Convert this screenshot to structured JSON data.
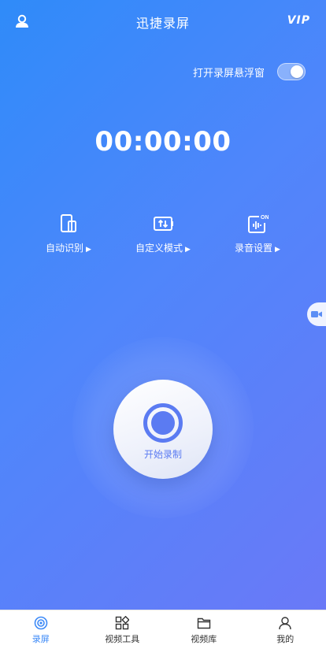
{
  "header": {
    "title": "迅捷录屏",
    "vip": "VIP",
    "user_icon": "user-icon"
  },
  "float_window": {
    "label": "打开录屏悬浮窗",
    "enabled": true
  },
  "timer": "00:00:00",
  "modes": [
    {
      "label": "自动识别",
      "icon": "phone-rotate-icon"
    },
    {
      "label": "自定义模式",
      "icon": "custom-settings-icon"
    },
    {
      "label": "录音设置",
      "icon": "audio-on-icon",
      "badge": "ON"
    }
  ],
  "record_button": {
    "label": "开始录制"
  },
  "tabs": [
    {
      "label": "录屏",
      "icon": "record-disc-icon",
      "active": true
    },
    {
      "label": "视频工具",
      "icon": "tools-grid-icon",
      "active": false
    },
    {
      "label": "视频库",
      "icon": "folder-icon",
      "active": false
    },
    {
      "label": "我的",
      "icon": "person-icon",
      "active": false
    }
  ],
  "colors": {
    "accent": "#3d8af7",
    "gradient_start": "#2f8bf9",
    "gradient_end": "#6a79f7",
    "button_ring": "#5b7bf2"
  }
}
